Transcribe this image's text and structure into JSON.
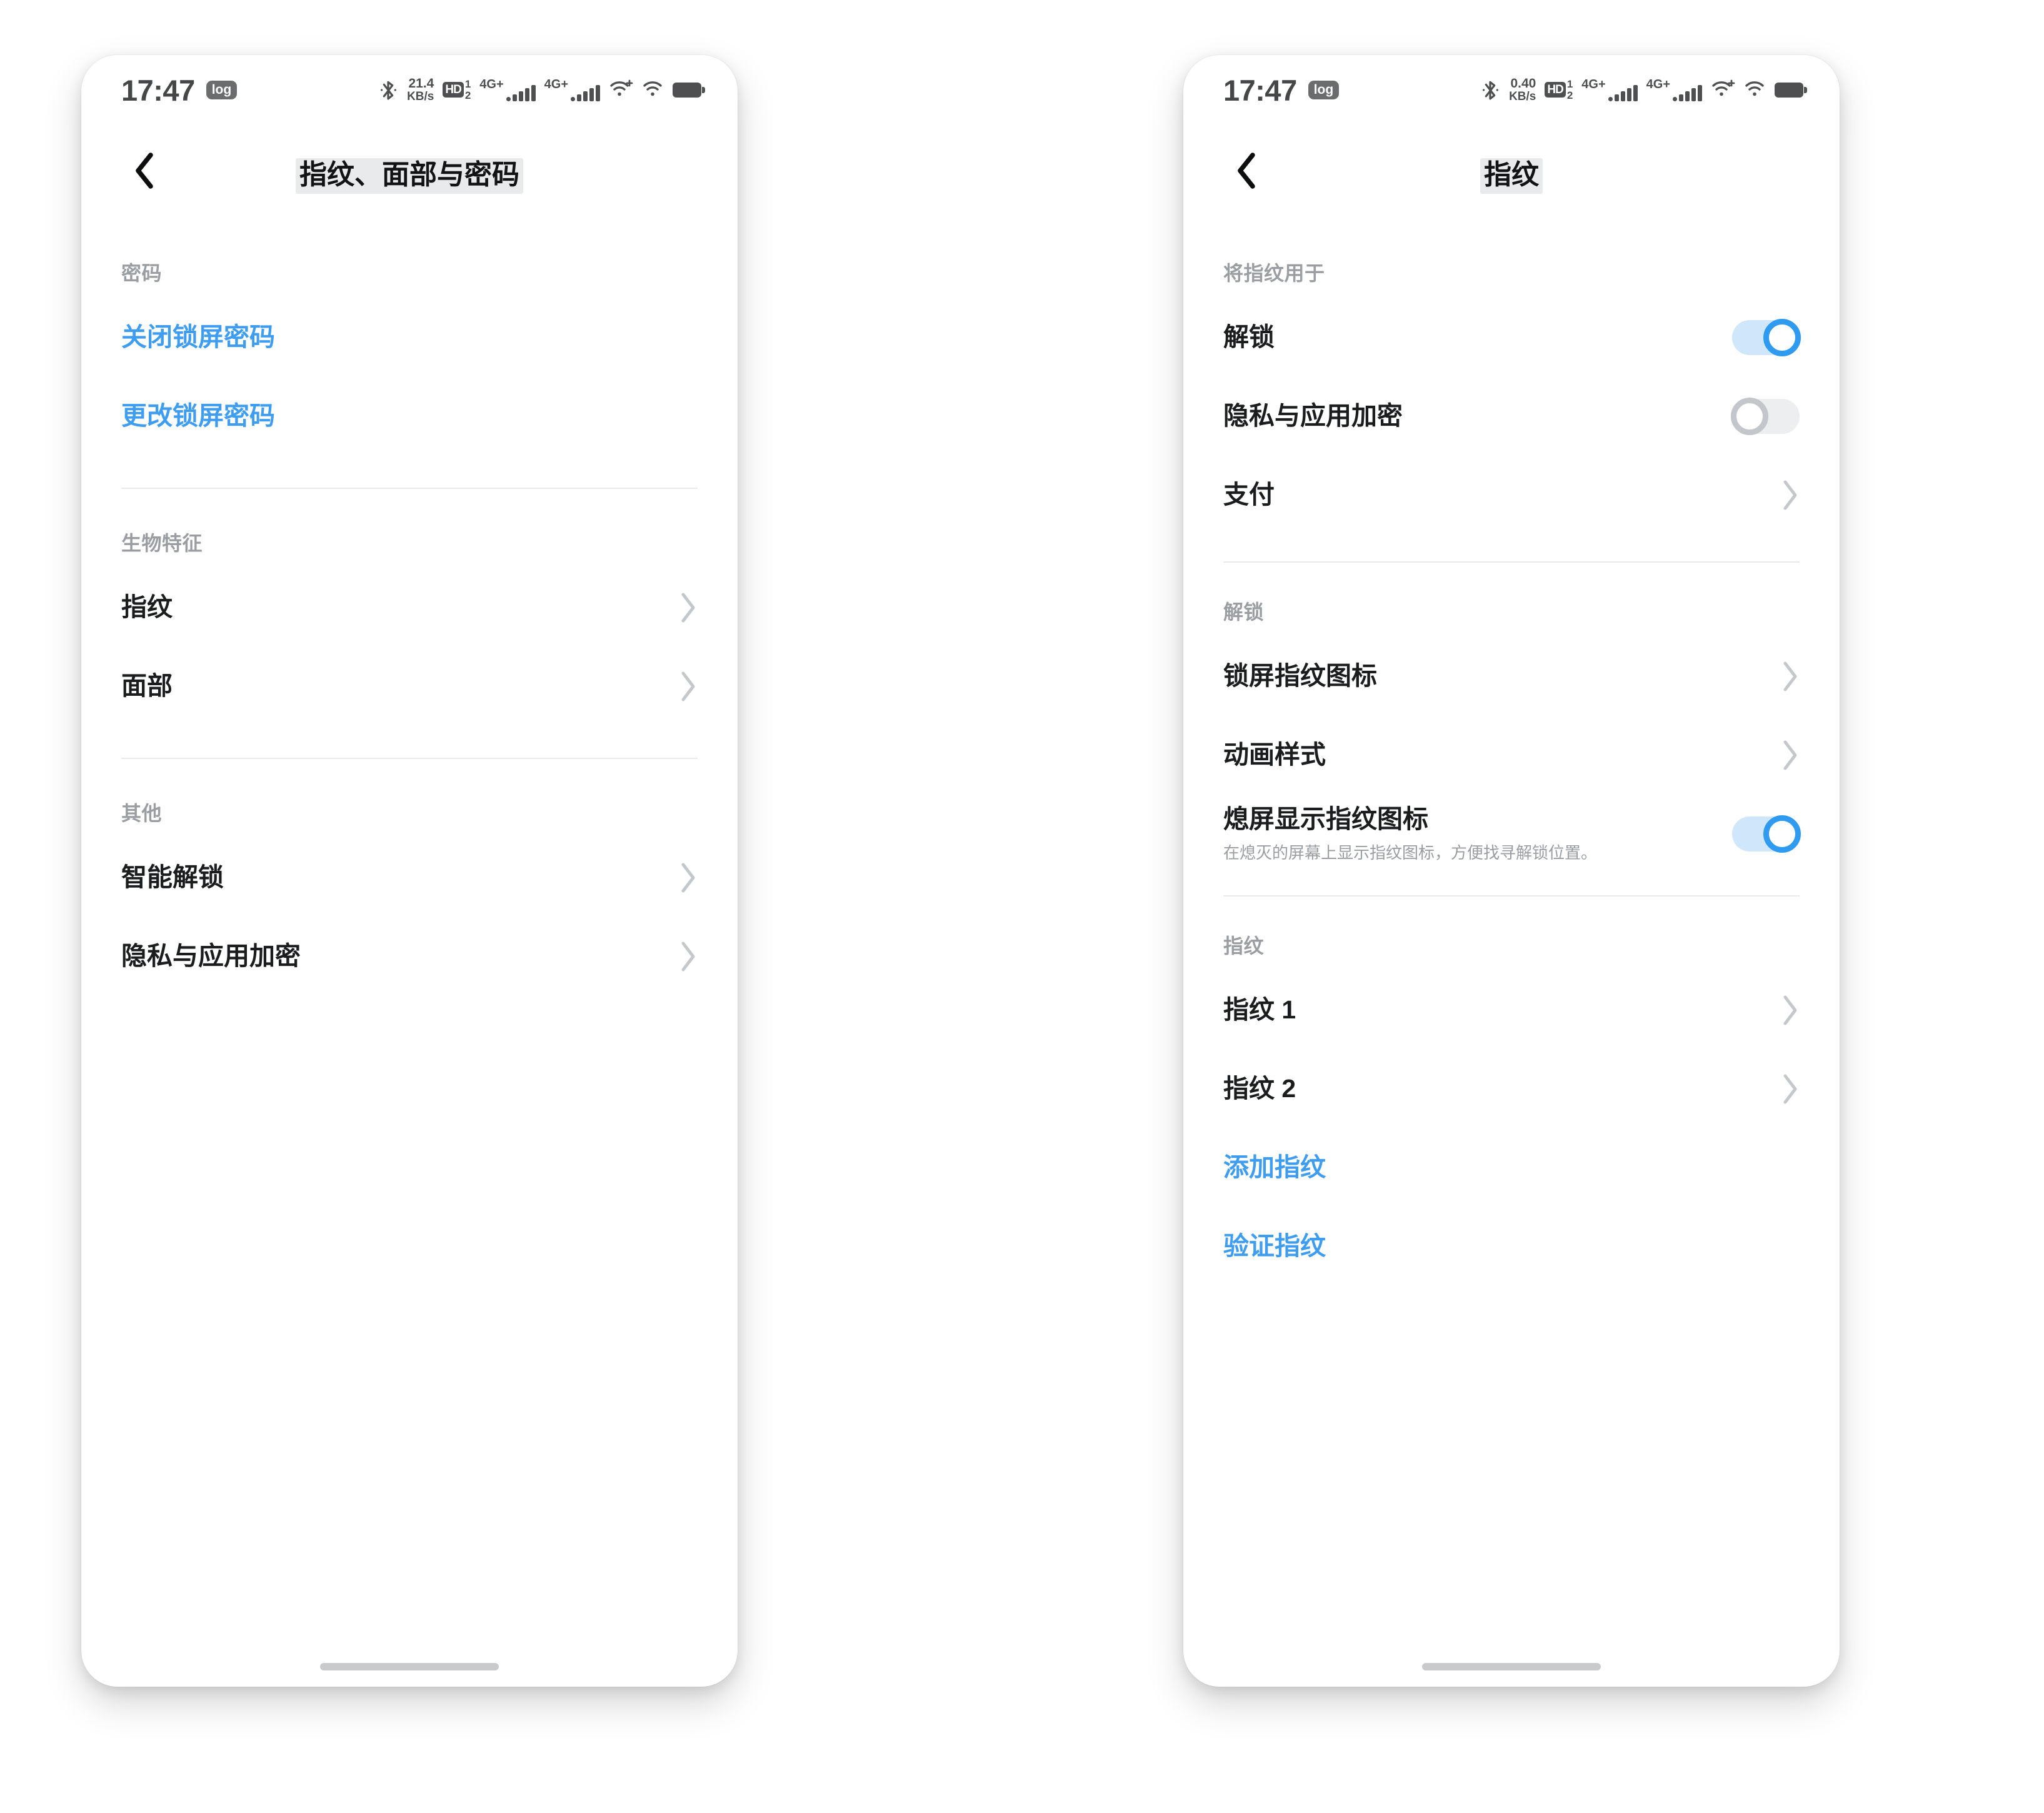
{
  "screens": [
    {
      "id": "fingerprint-face-password",
      "status_bar": {
        "time": "17:47",
        "log_badge": "log",
        "bluetooth_icon": "bluetooth-icon",
        "net_speed_value": "21.4",
        "net_speed_unit": "KB/s",
        "hd_label": "HD",
        "hd_sim_1": "1",
        "hd_sim_2": "2",
        "sim1_network": "4G+",
        "sim2_network": "4G+",
        "wifi_plus_icon": "wifi-plus-icon",
        "wifi_icon": "wifi-icon",
        "battery_icon": "battery-full-icon"
      },
      "nav": {
        "back_icon": "chevron-left-icon",
        "title": "指纹、面部与密码"
      },
      "sections": [
        {
          "header": "密码",
          "rows": [
            {
              "title": "关闭锁屏密码",
              "style": "link",
              "chevron": false
            },
            {
              "title": "更改锁屏密码",
              "style": "link",
              "chevron": false
            }
          ]
        },
        {
          "header": "生物特征",
          "rows": [
            {
              "title": "指纹",
              "style": "normal",
              "chevron": true
            },
            {
              "title": "面部",
              "style": "normal",
              "chevron": true
            }
          ]
        },
        {
          "header": "其他",
          "rows": [
            {
              "title": "智能解锁",
              "style": "normal",
              "chevron": true
            },
            {
              "title": "隐私与应用加密",
              "style": "normal",
              "chevron": true
            }
          ]
        }
      ]
    },
    {
      "id": "fingerprint",
      "status_bar": {
        "time": "17:47",
        "log_badge": "log",
        "bluetooth_icon": "bluetooth-icon",
        "net_speed_value": "0.40",
        "net_speed_unit": "KB/s",
        "hd_label": "HD",
        "hd_sim_1": "1",
        "hd_sim_2": "2",
        "sim1_network": "4G+",
        "sim2_network": "4G+",
        "wifi_plus_icon": "wifi-plus-icon",
        "wifi_icon": "wifi-icon",
        "battery_icon": "battery-full-icon"
      },
      "nav": {
        "back_icon": "chevron-left-icon",
        "title": "指纹"
      },
      "sections": [
        {
          "header": "将指纹用于",
          "rows": [
            {
              "title": "解锁",
              "style": "normal",
              "control": "toggle",
              "toggle_state": "on"
            },
            {
              "title": "隐私与应用加密",
              "style": "normal",
              "control": "toggle",
              "toggle_state": "off"
            },
            {
              "title": "支付",
              "style": "normal",
              "chevron": true
            }
          ]
        },
        {
          "header": "解锁",
          "rows": [
            {
              "title": "锁屏指纹图标",
              "style": "normal",
              "chevron": true
            },
            {
              "title": "动画样式",
              "style": "normal",
              "chevron": true
            },
            {
              "title": "熄屏显示指纹图标",
              "desc": "在熄灭的屏幕上显示指纹图标，方便找寻解锁位置。",
              "style": "normal",
              "control": "toggle",
              "toggle_state": "on"
            }
          ]
        },
        {
          "header": "指纹",
          "rows": [
            {
              "title": "指纹 1",
              "style": "normal",
              "chevron": true
            },
            {
              "title": "指纹 2",
              "style": "normal",
              "chevron": true
            },
            {
              "title": "添加指纹",
              "style": "link",
              "chevron": false
            },
            {
              "title": "验证指纹",
              "style": "link",
              "chevron": false
            }
          ]
        }
      ]
    }
  ],
  "colors": {
    "link_blue": "#3e9df0",
    "toggle_on_track": "#cfe6fb",
    "toggle_on_thumb_ring": "#2f9bf0",
    "toggle_off_track": "#eceef0",
    "toggle_off_thumb_ring": "#c3c6ca",
    "group_header_gray": "#9a9da1",
    "title_black": "#1a1c1e",
    "divider_gray": "#e9eaec"
  }
}
